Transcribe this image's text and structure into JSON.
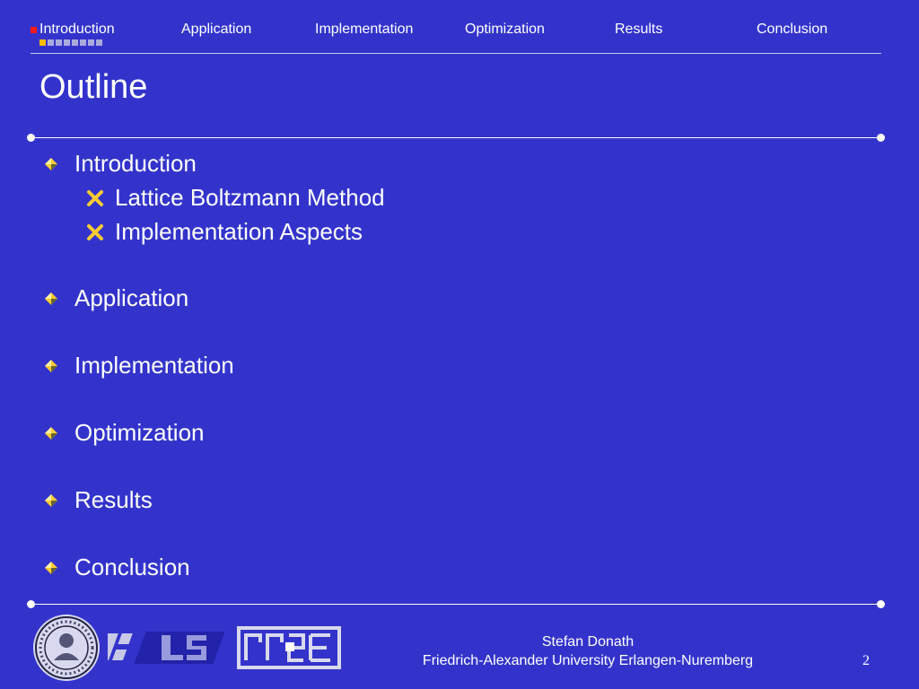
{
  "nav": {
    "items": [
      {
        "label": "Introduction"
      },
      {
        "label": "Application"
      },
      {
        "label": "Implementation"
      },
      {
        "label": "Optimization"
      },
      {
        "label": "Results"
      },
      {
        "label": "Conclusion"
      }
    ],
    "active_index": 0
  },
  "slide": {
    "title": "Outline",
    "outline": [
      {
        "label": "Introduction",
        "subitems": [
          "Lattice Boltzmann Method",
          "Implementation Aspects"
        ]
      },
      {
        "label": "Application"
      },
      {
        "label": "Implementation"
      },
      {
        "label": "Optimization"
      },
      {
        "label": "Results"
      },
      {
        "label": "Conclusion"
      }
    ]
  },
  "footer": {
    "author": "Stefan Donath",
    "affiliation": "Friedrich-Alexander University Erlangen-Nuremberg",
    "page_number": "2",
    "logos": [
      "university-seal-logo",
      "lss-logo",
      "rrze-logo"
    ]
  },
  "colors": {
    "background": "#3333cc",
    "text": "#ffffff",
    "active_marker": "#ff1a1a",
    "bullet_gold": "#ffcc33",
    "progress_inactive": "#aaaadd",
    "progress_current": "#ffbb00"
  }
}
